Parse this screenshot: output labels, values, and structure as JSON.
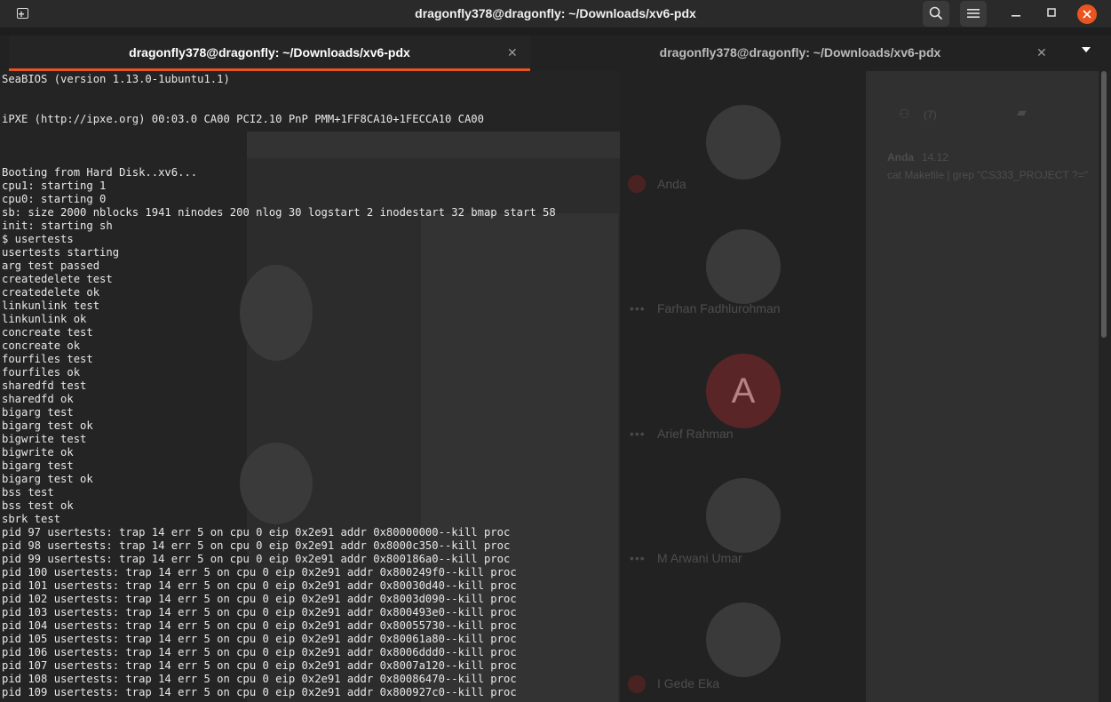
{
  "window": {
    "title": "dragonfly378@dragonfly: ~/Downloads/xv6-pdx"
  },
  "tabs": [
    {
      "label": "dragonfly378@dragonfly: ~/Downloads/xv6-pdx",
      "active": true
    },
    {
      "label": "dragonfly378@dragonfly: ~/Downloads/xv6-pdx",
      "active": false
    }
  ],
  "icons": {
    "new_tab": "new-tab-icon",
    "search": "search-icon",
    "menu": "hamburger-menu-icon",
    "minimize": "minimize-icon",
    "maximize": "maximize-icon",
    "close": "close-icon",
    "tab_close": "close-icon",
    "tab_dropdown": "chevron-down-icon"
  },
  "colors": {
    "accent": "#e95420",
    "terminal_bg": "#242424",
    "terminal_fg": "#e8e8e8"
  },
  "background_meet": {
    "participants": [
      {
        "name": "Anda"
      },
      {
        "name": "Farhan Fadhlurohman"
      },
      {
        "name": "Arief Rahman",
        "initial": "A"
      },
      {
        "name": "M Arwani Umar"
      },
      {
        "name": "I Gede Eka"
      }
    ],
    "chat": {
      "people_count": "(7)",
      "author": "Anda",
      "time": "14.12",
      "message": "cat Makefile | grep \"CS333_PROJECT ?=\""
    }
  },
  "terminal": {
    "lines": [
      "SeaBIOS (version 1.13.0-1ubuntu1.1)",
      "",
      "",
      "iPXE (http://ipxe.org) 00:03.0 CA00 PCI2.10 PnP PMM+1FF8CA10+1FECCA10 CA00",
      "",
      "",
      "",
      "Booting from Hard Disk..xv6...",
      "cpu1: starting 1",
      "cpu0: starting 0",
      "sb: size 2000 nblocks 1941 ninodes 200 nlog 30 logstart 2 inodestart 32 bmap start 58",
      "init: starting sh",
      "$ usertests",
      "usertests starting",
      "arg test passed",
      "createdelete test",
      "createdelete ok",
      "linkunlink test",
      "linkunlink ok",
      "concreate test",
      "concreate ok",
      "fourfiles test",
      "fourfiles ok",
      "sharedfd test",
      "sharedfd ok",
      "bigarg test",
      "bigarg test ok",
      "bigwrite test",
      "bigwrite ok",
      "bigarg test",
      "bigarg test ok",
      "bss test",
      "bss test ok",
      "sbrk test",
      "pid 97 usertests: trap 14 err 5 on cpu 0 eip 0x2e91 addr 0x80000000--kill proc",
      "pid 98 usertests: trap 14 err 5 on cpu 0 eip 0x2e91 addr 0x8000c350--kill proc",
      "pid 99 usertests: trap 14 err 5 on cpu 0 eip 0x2e91 addr 0x800186a0--kill proc",
      "pid 100 usertests: trap 14 err 5 on cpu 0 eip 0x2e91 addr 0x800249f0--kill proc",
      "pid 101 usertests: trap 14 err 5 on cpu 0 eip 0x2e91 addr 0x80030d40--kill proc",
      "pid 102 usertests: trap 14 err 5 on cpu 0 eip 0x2e91 addr 0x8003d090--kill proc",
      "pid 103 usertests: trap 14 err 5 on cpu 0 eip 0x2e91 addr 0x800493e0--kill proc",
      "pid 104 usertests: trap 14 err 5 on cpu 0 eip 0x2e91 addr 0x80055730--kill proc",
      "pid 105 usertests: trap 14 err 5 on cpu 0 eip 0x2e91 addr 0x80061a80--kill proc",
      "pid 106 usertests: trap 14 err 5 on cpu 0 eip 0x2e91 addr 0x8006ddd0--kill proc",
      "pid 107 usertests: trap 14 err 5 on cpu 0 eip 0x2e91 addr 0x8007a120--kill proc",
      "pid 108 usertests: trap 14 err 5 on cpu 0 eip 0x2e91 addr 0x80086470--kill proc",
      "pid 109 usertests: trap 14 err 5 on cpu 0 eip 0x2e91 addr 0x800927c0--kill proc"
    ]
  }
}
